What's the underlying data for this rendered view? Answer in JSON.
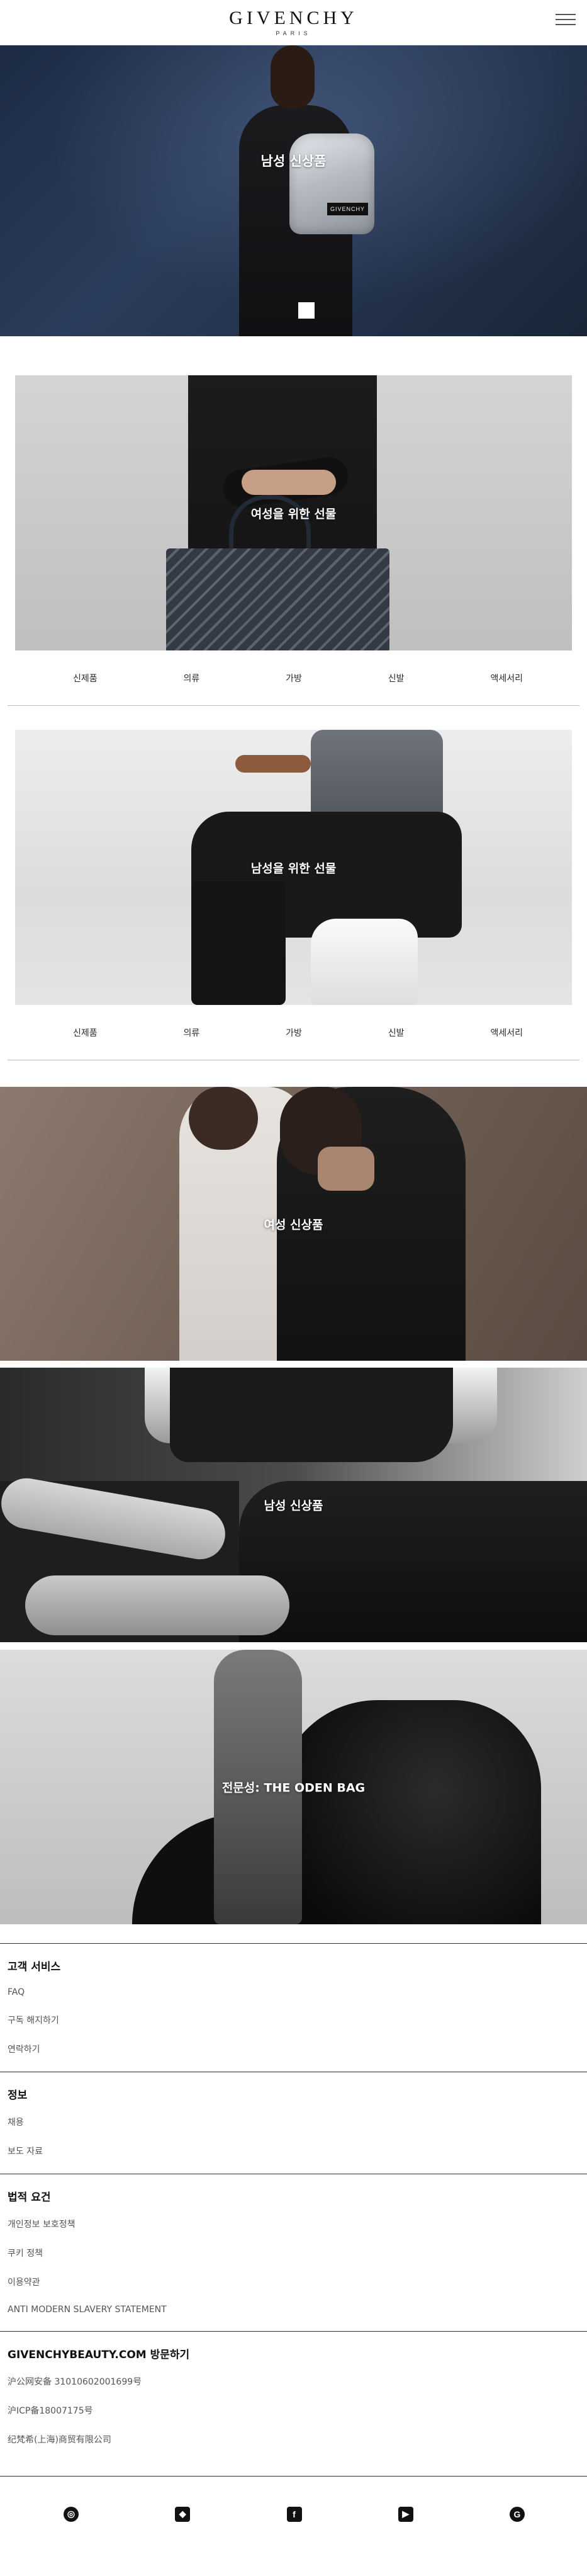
{
  "header": {
    "logo_text": "GIVENCHY",
    "logo_subtext": "PARIS"
  },
  "hero": {
    "title": "남성 신상품",
    "bag_print": "GIVENCHY"
  },
  "gift_women": {
    "title": "여성을 위한 선물",
    "categories": [
      "신제품",
      "의류",
      "가방",
      "신발",
      "액세서리"
    ]
  },
  "gift_men": {
    "title": "남성을 위한 선물",
    "categories": [
      "신제품",
      "의류",
      "가방",
      "신발",
      "액세서리"
    ]
  },
  "features": {
    "women_new": "여성 신상품",
    "men_new": "남성 신상품",
    "antigona": "전문성: THE ODEN BAG"
  },
  "footer": {
    "customer_service": {
      "heading": "고객 서비스",
      "links": [
        "FAQ",
        "구독 해지하기",
        "연락하기"
      ]
    },
    "info": {
      "heading": "정보",
      "links": [
        "채용",
        "보도 자료"
      ]
    },
    "legal": {
      "heading": "법적 요건",
      "links": [
        "개인정보 보호정책",
        "쿠키 정책",
        "이용약관",
        "ANTI MODERN SLAVERY STATEMENT"
      ]
    },
    "beauty": {
      "heading": "GIVENCHYBEAUTY.COM 방문하기",
      "lines": [
        "沪公网安备 31010602001699号",
        "沪ICP备18007175号",
        "纪梵希(上海)商贸有限公司"
      ]
    },
    "social": [
      {
        "name": "instagram-icon",
        "glyph": "◎"
      },
      {
        "name": "wechat-icon",
        "glyph": "◆"
      },
      {
        "name": "facebook-icon",
        "glyph": "f"
      },
      {
        "name": "youtube-icon",
        "glyph": "▶"
      },
      {
        "name": "google-icon",
        "glyph": "G"
      }
    ]
  },
  "colors": {
    "hero_bg": "#2b3d5c",
    "divider": "#2f2f2f",
    "text_muted": "#555555"
  }
}
